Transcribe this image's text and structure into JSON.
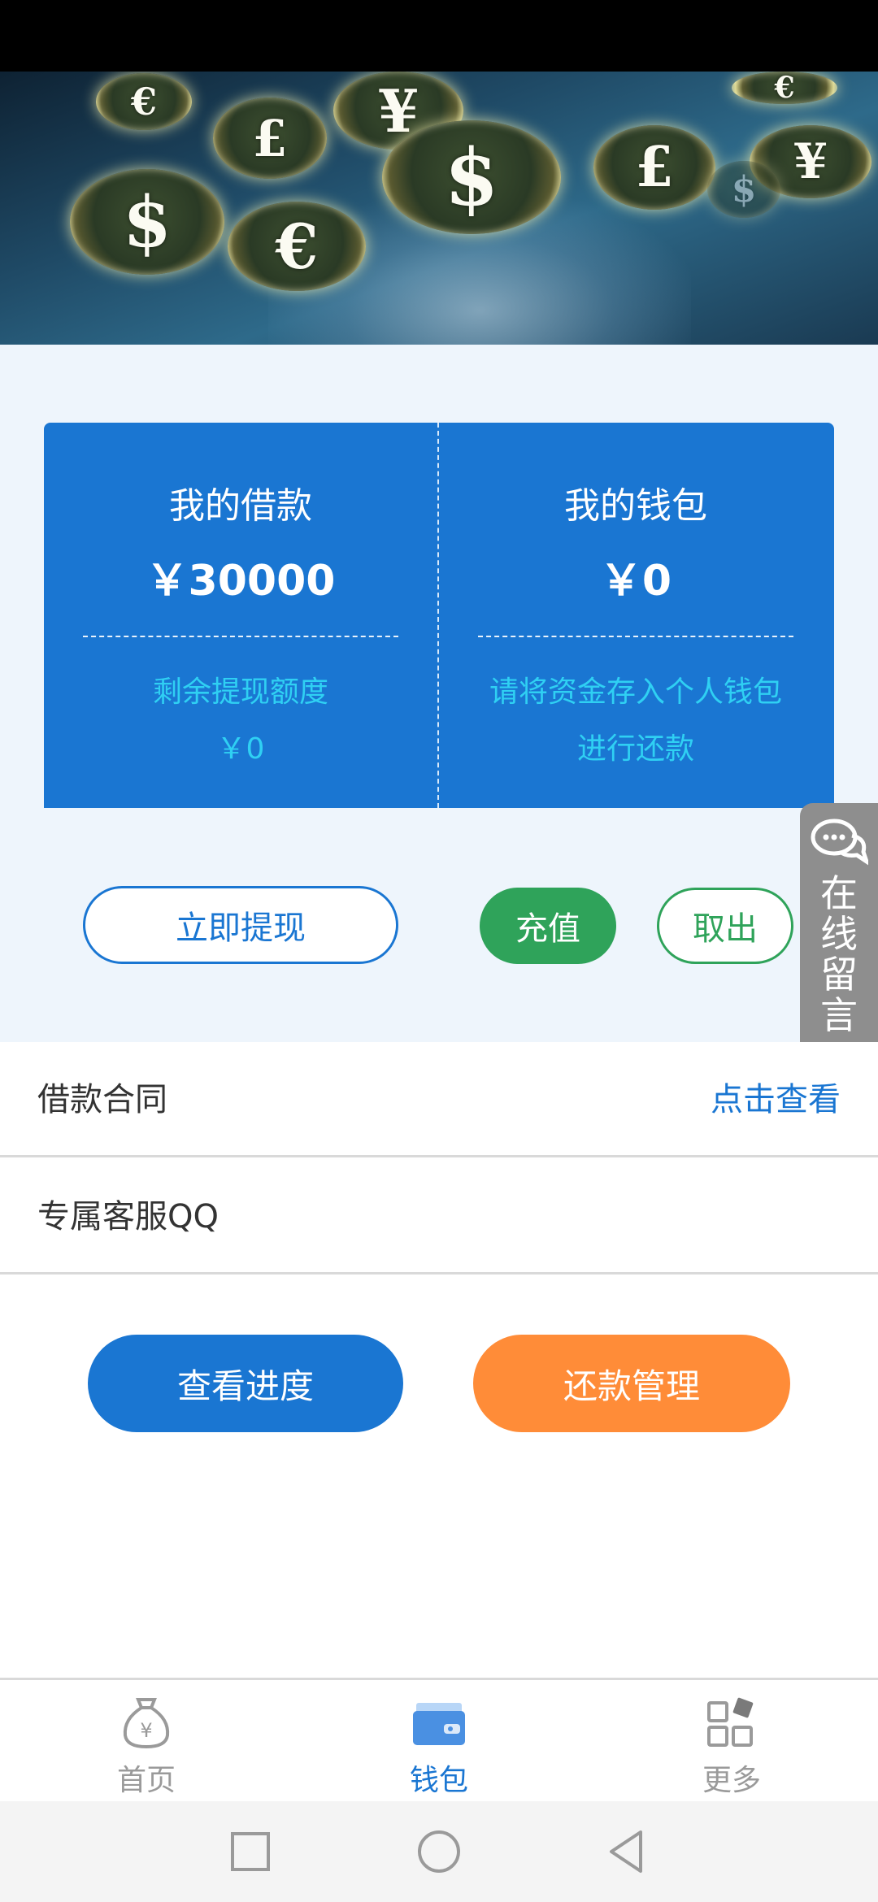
{
  "banner": {
    "coins": [
      "€",
      "£",
      "¥",
      "$",
      "$",
      "€",
      "£",
      "¥",
      "€",
      "$"
    ]
  },
  "loan_card": {
    "left": {
      "title": "我的借款",
      "amount": "￥30000",
      "sub_label": "剩余提现额度",
      "sub_value": "￥0"
    },
    "right": {
      "title": "我的钱包",
      "amount": "￥0",
      "note_line1": "请将资金存入个人钱包",
      "note_line2": "进行还款"
    }
  },
  "actions": {
    "withdraw": "立即提现",
    "recharge": "充值",
    "takeout": "取出"
  },
  "side_tab": {
    "label": "在线留言"
  },
  "rows": {
    "contract_label": "借款合同",
    "contract_link": "点击查看",
    "qq_label": "专属客服QQ"
  },
  "bottom_buttons": {
    "progress": "查看进度",
    "repay": "还款管理"
  },
  "tabbar": {
    "home": "首页",
    "wallet": "钱包",
    "more": "更多",
    "active": "wallet"
  },
  "colors": {
    "primary_blue": "#1a76d2",
    "green": "#2fa35a",
    "orange": "#ff8c38",
    "cyan_text": "#2fd0f3",
    "page_bg": "#eef5fc"
  }
}
